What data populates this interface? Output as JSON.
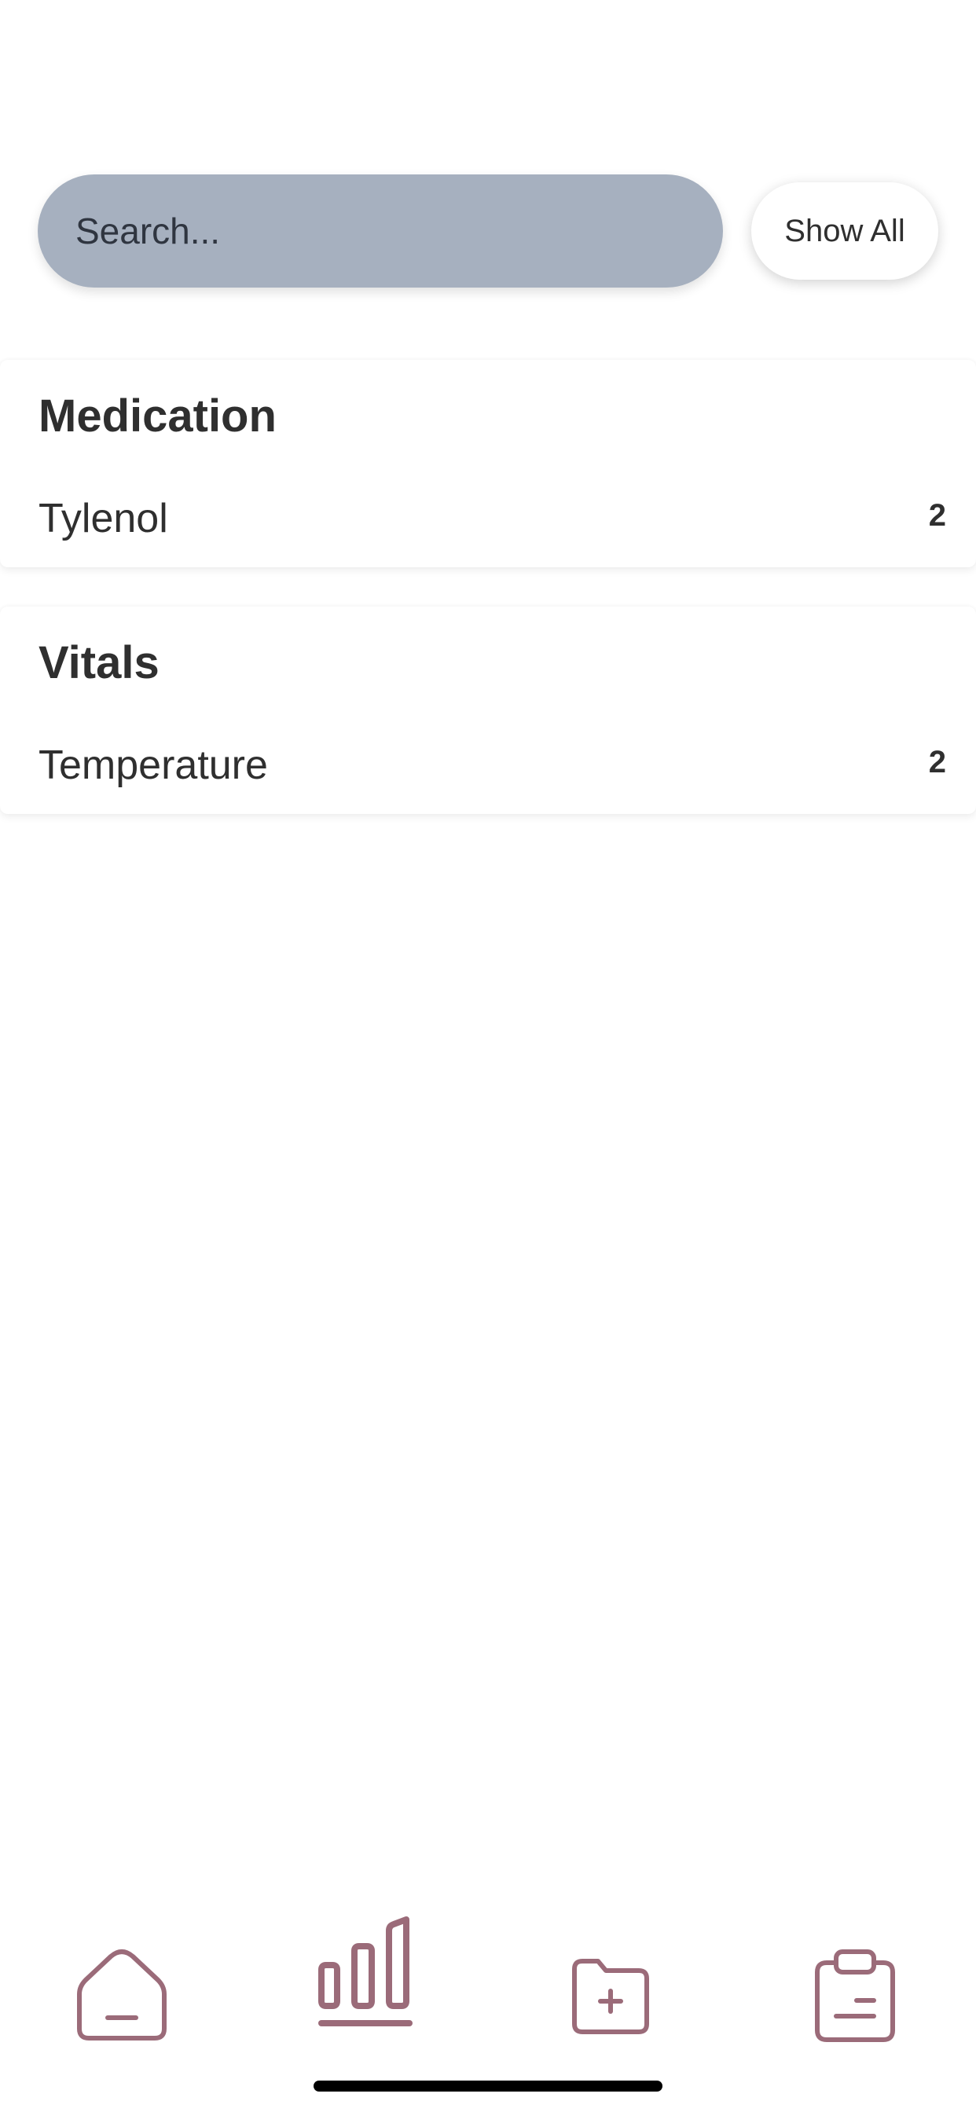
{
  "search": {
    "placeholder": "Search...",
    "value": ""
  },
  "show_all_label": "Show All",
  "sections": [
    {
      "title": "Medication",
      "items": [
        {
          "label": "Tylenol",
          "count": "2"
        }
      ]
    },
    {
      "title": "Vitals",
      "items": [
        {
          "label": "Temperature",
          "count": "2"
        }
      ]
    }
  ],
  "bottom_nav": {
    "items": [
      {
        "icon": "home-icon",
        "active": false
      },
      {
        "icon": "bar-chart-icon",
        "active": true
      },
      {
        "icon": "folder-add-icon",
        "active": false
      },
      {
        "icon": "clipboard-icon",
        "active": false
      }
    ],
    "icon_color": "#9b6b79"
  }
}
